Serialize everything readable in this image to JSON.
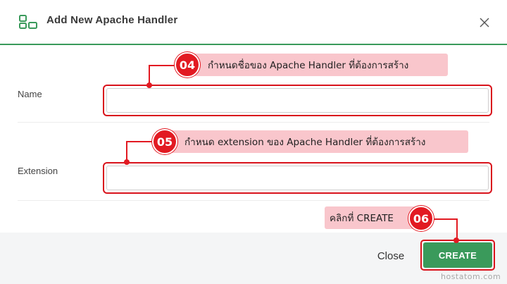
{
  "dialog": {
    "title": "Add New Apache Handler",
    "icon": "handler-grid-icon",
    "close_icon": "close-icon"
  },
  "fields": [
    {
      "label": "Name",
      "value": "",
      "placeholder": ""
    },
    {
      "label": "Extension",
      "value": "",
      "placeholder": ""
    }
  ],
  "annotations": [
    {
      "number": "04",
      "text": "กำหนดชื่อของ Apache Handler ที่ต้องการสร้าง"
    },
    {
      "number": "05",
      "text": "กำหนด extension ของ Apache Handler ที่ต้องการสร้าง"
    },
    {
      "number": "06",
      "text": "คลิกที่ CREATE"
    }
  ],
  "footer": {
    "close_label": "Close",
    "create_label": "CREATE"
  },
  "watermark": "hostatom.com",
  "colors": {
    "accent": "#3a9a5b",
    "annotation_red": "#e21a22",
    "callout_pink": "#f9c6cc",
    "footer_bg": "#f4f5f6"
  }
}
